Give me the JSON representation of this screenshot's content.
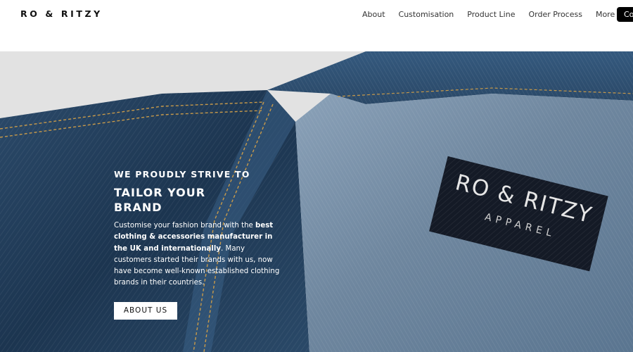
{
  "header": {
    "logo": "RO & RITZY",
    "nav": [
      "About",
      "Customisation",
      "Product Line",
      "Order Process",
      "More"
    ],
    "cta_label": "Co"
  },
  "hero": {
    "kicker": "WE PROUDLY STRIVE TO",
    "headline": "TAILOR YOUR BRAND",
    "body_part1": "Customise your fashion brand with the ",
    "body_bold": "best clothing & accessories manufacturer in the UK and internationally",
    "body_part2": ". Many customers started their brands with us, now have become well-known established clothing brands in their countries.",
    "button_label": "ABOUT US",
    "label_line1": "RO & RITZY",
    "label_line2": "APPAREL"
  },
  "colors": {
    "denim_dark": "#1f3a55",
    "denim_light": "#6e8aa6",
    "label_bg": "#141a26",
    "header_bg": "#ffffff"
  }
}
